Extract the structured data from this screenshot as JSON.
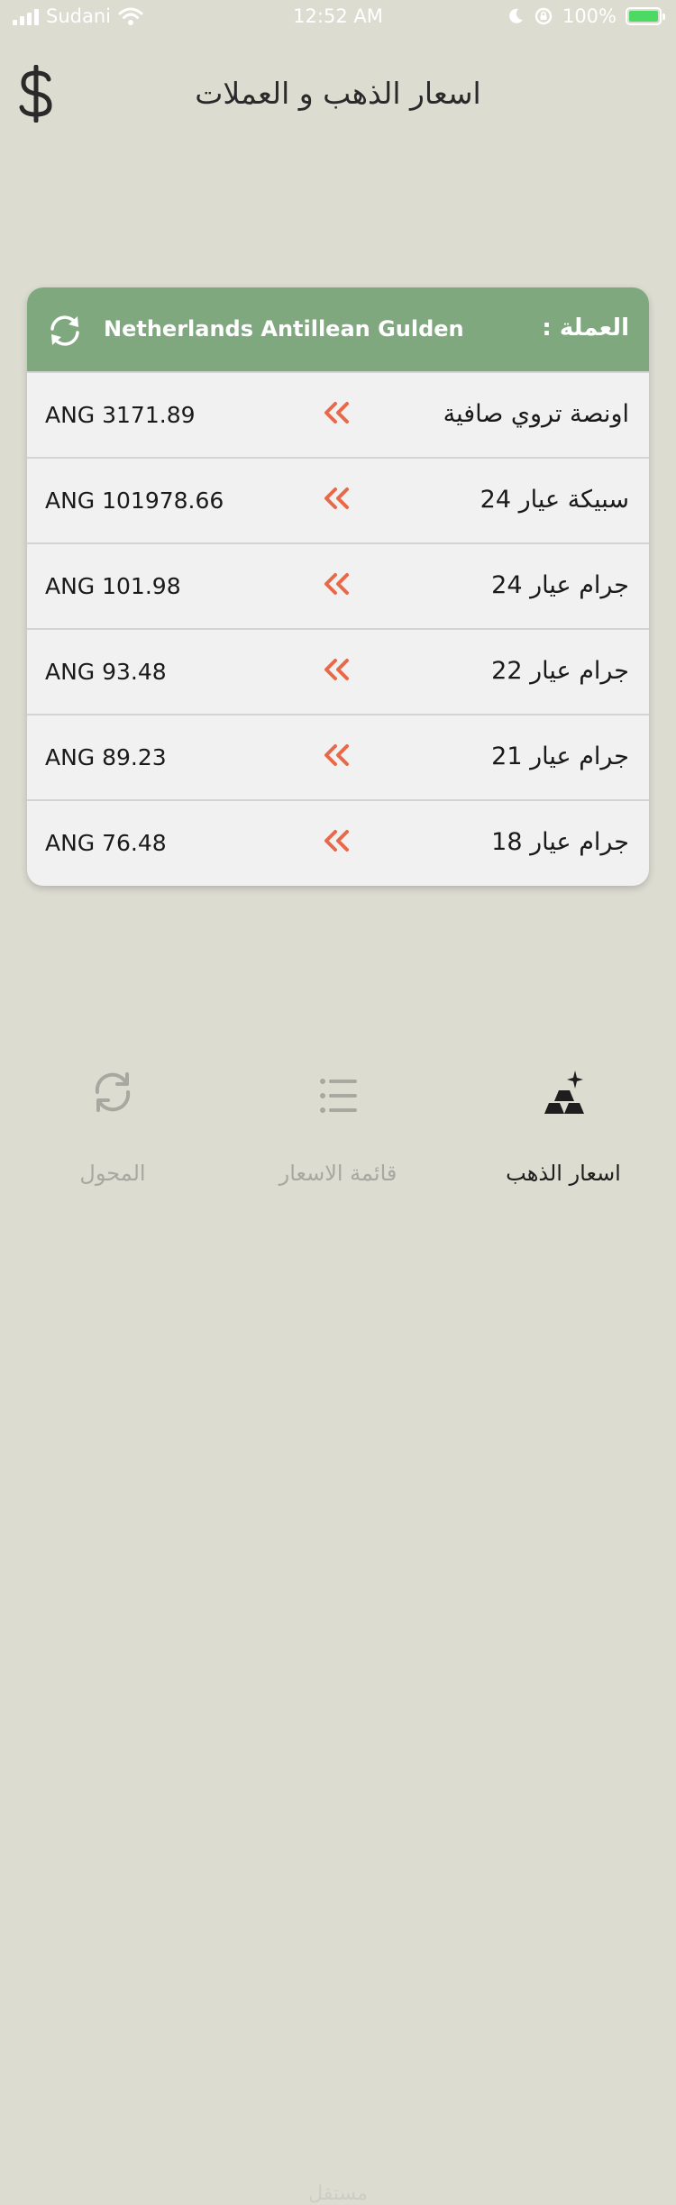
{
  "status": {
    "carrier": "Sudani",
    "time": "12:52 AM",
    "battery": "100%"
  },
  "header": {
    "title": "اسعار الذهب و العملات"
  },
  "card": {
    "currency_label": "العملة :",
    "currency_name": "Netherlands Antillean Gulden",
    "rows": [
      {
        "label": "اونصة تروي صافية",
        "value": "ANG 3171.89"
      },
      {
        "label": "سبيكة عيار 24",
        "value": "ANG 101978.66"
      },
      {
        "label": "جرام عيار 24",
        "value": "ANG 101.98"
      },
      {
        "label": "جرام عيار 22",
        "value": "ANG 93.48"
      },
      {
        "label": "جرام عيار 21",
        "value": "ANG 89.23"
      },
      {
        "label": "جرام عيار 18",
        "value": "ANG 76.48"
      }
    ]
  },
  "tabs": {
    "converter": "المحول",
    "price_list": "قائمة الاسعار",
    "gold_prices": "اسعار الذهب"
  },
  "watermark": "مستقل",
  "colors": {
    "background": "#dcdcd1",
    "card_header": "#7fa87f",
    "chevron": "#e8694a",
    "tab_inactive": "#a8a8a0",
    "tab_active": "#1e1e1e"
  },
  "icons": {
    "header": "dollar-icon",
    "card_header": "refresh-icon",
    "row": "double-chevron-left-icon",
    "tabs": [
      "sync-icon",
      "list-icon",
      "gold-bars-icon"
    ]
  }
}
